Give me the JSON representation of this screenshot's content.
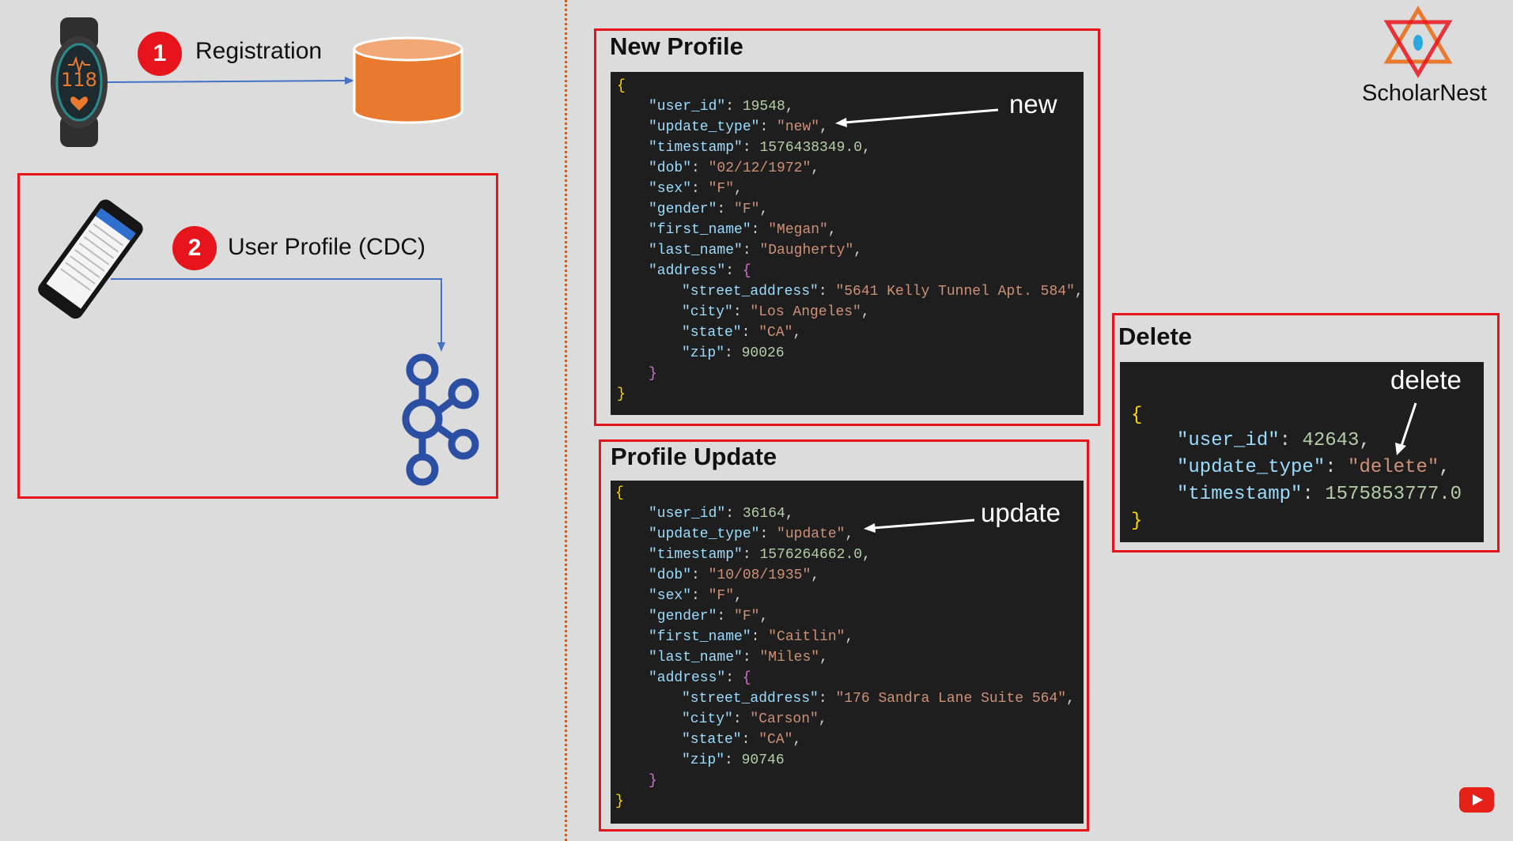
{
  "left": {
    "step1": {
      "number": "1",
      "label": "Registration"
    },
    "step2": {
      "number": "2",
      "label": "User Profile (CDC)"
    },
    "watch_reading": "118"
  },
  "logo": {
    "name": "ScholarNest"
  },
  "new_profile": {
    "title": "New Profile",
    "annotation": "new",
    "user_id": "19548",
    "update_type": "\"new\"",
    "timestamp": "1576438349.0",
    "dob": "\"02/12/1972\"",
    "sex": "\"F\"",
    "gender": "\"F\"",
    "first_name": "\"Megan\"",
    "last_name": "\"Daugherty\"",
    "street_address": "\"5641 Kelly Tunnel Apt. 584\"",
    "city": "\"Los Angeles\"",
    "state": "\"CA\"",
    "zip": "90026"
  },
  "profile_update": {
    "title": "Profile Update",
    "annotation": "update",
    "user_id": "36164",
    "update_type": "\"update\"",
    "timestamp": "1576264662.0",
    "dob": "\"10/08/1935\"",
    "sex": "\"F\"",
    "gender": "\"F\"",
    "first_name": "\"Caitlin\"",
    "last_name": "\"Miles\"",
    "street_address": "\"176 Sandra Lane Suite 564\"",
    "city": "\"Carson\"",
    "state": "\"CA\"",
    "zip": "90746"
  },
  "delete": {
    "title": "Delete",
    "annotation": "delete",
    "user_id": "42643",
    "update_type": "\"delete\"",
    "timestamp": "1575853777.0"
  },
  "keys": {
    "user_id": "\"user_id\"",
    "update_type": "\"update_type\"",
    "timestamp": "\"timestamp\"",
    "dob": "\"dob\"",
    "sex": "\"sex\"",
    "gender": "\"gender\"",
    "first_name": "\"first_name\"",
    "last_name": "\"last_name\"",
    "address": "\"address\"",
    "street_address": "\"street_address\"",
    "city": "\"city\"",
    "state": "\"state\"",
    "zip": "\"zip\""
  },
  "colors": {
    "box_border": "#e8141b",
    "step_badge": "#e8141b",
    "database": "#e8792f",
    "kafka": "#2b4fa3",
    "connector_line": "#4472c4"
  },
  "icons": [
    "fitness-watch-icon",
    "database-icon",
    "smartphone-icon",
    "kafka-icon",
    "scholarnest-logo-icon",
    "youtube-icon"
  ]
}
